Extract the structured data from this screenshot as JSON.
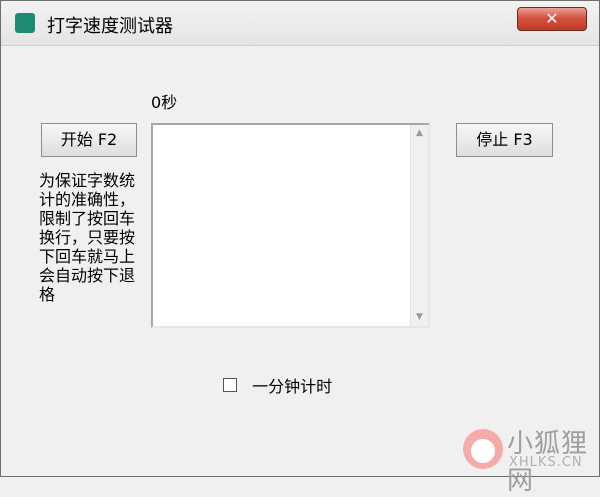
{
  "window": {
    "title": "打字速度测试器",
    "close_label": "✕"
  },
  "timer": {
    "value": "0秒"
  },
  "buttons": {
    "start_label": "开始 F2",
    "stop_label": "停止 F3"
  },
  "note": "为保证字数统计的准确性，限制了按回车换行，只要按下回车就马上会自动按下退格",
  "checkbox": {
    "label": "一分钟计时",
    "checked": false
  },
  "watermark": {
    "text": "小狐狸网",
    "sub": "XHLKS.CN"
  },
  "icons": [
    "app-icon",
    "close-icon",
    "scroll-up-icon",
    "scroll-down-icon",
    "fox-logo-icon"
  ]
}
